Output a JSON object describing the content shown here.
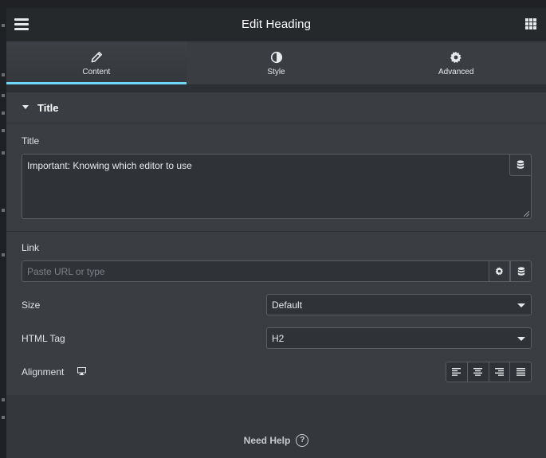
{
  "header": {
    "title": "Edit Heading",
    "menu_icon": "hamburger-icon",
    "apps_icon": "grid-icon"
  },
  "tabs": [
    {
      "label": "Content",
      "icon": "pencil-icon",
      "active": true
    },
    {
      "label": "Style",
      "icon": "half-circle-icon",
      "active": false
    },
    {
      "label": "Advanced",
      "icon": "gear-icon",
      "active": false
    }
  ],
  "section": {
    "title": "Title",
    "expanded": true
  },
  "controls": {
    "title": {
      "label": "Title",
      "value": "Important: Knowing which editor to use"
    },
    "link": {
      "label": "Link",
      "placeholder": "Paste URL or type"
    },
    "size": {
      "label": "Size",
      "value": "Default"
    },
    "html_tag": {
      "label": "HTML Tag",
      "value": "H2"
    },
    "alignment": {
      "label": "Alignment",
      "responsive_icon": "desktop-icon",
      "options": [
        "left",
        "center",
        "right",
        "justify"
      ]
    }
  },
  "footer": {
    "help_label": "Need Help",
    "help_icon": "question-icon"
  },
  "colors": {
    "accent": "#71d7f7",
    "panel": "#34383c",
    "header": "#26292c"
  }
}
